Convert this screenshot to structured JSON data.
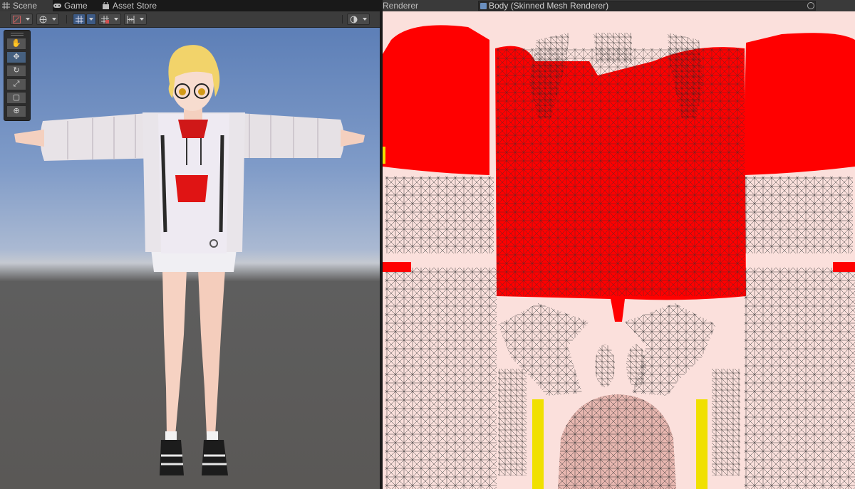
{
  "tabs": [
    {
      "label": "Scene",
      "icon": "grid-icon"
    },
    {
      "label": "Game",
      "icon": "gamepad-icon"
    },
    {
      "label": "Asset Store",
      "icon": "shopping-bag-icon"
    }
  ],
  "scene_tools": [
    "hand-tool",
    "move-tool",
    "rotate-tool",
    "scale-tool",
    "rect-tool",
    "transform-tool"
  ],
  "renderer_panel": {
    "label": "Renderer",
    "selected_object": "Body (Skinned Mesh Renderer)",
    "object_icon": "skinned-mesh-icon",
    "picker_icon": "object-picker-icon"
  },
  "colors": {
    "accent": "#3d5a85",
    "uv_fill": "#ff0000",
    "uv_background": "#fbe0dc",
    "highlight_yellow": "#f0e000"
  }
}
